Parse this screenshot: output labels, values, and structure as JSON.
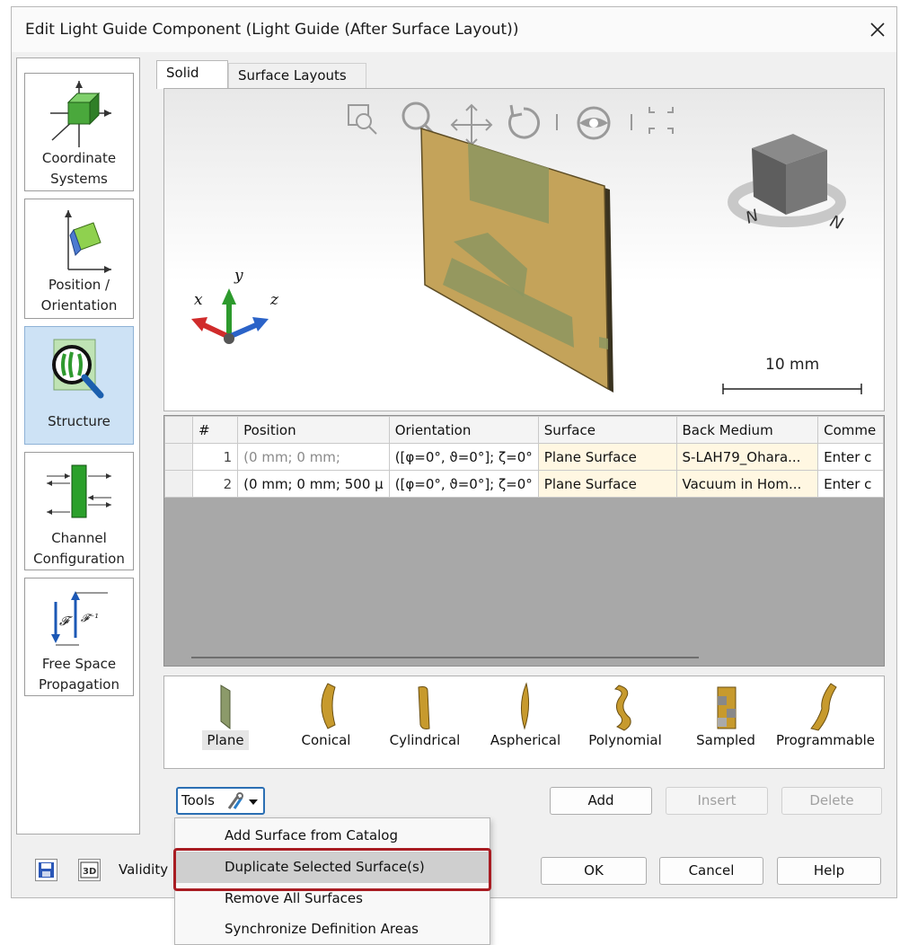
{
  "window": {
    "title": "Edit Light Guide Component (Light Guide (After Surface Layout))"
  },
  "nav": {
    "items": [
      {
        "label1": "Coordinate",
        "label2": "Systems"
      },
      {
        "label1": "Position /",
        "label2": "Orientation"
      },
      {
        "label1": "Structure",
        "label2": ""
      },
      {
        "label1": "Channel",
        "label2": "Configuration"
      },
      {
        "label1": "Free Space",
        "label2": "Propagation"
      }
    ]
  },
  "tabs": [
    {
      "label": "Solid"
    },
    {
      "label": "Surface Layouts"
    }
  ],
  "viewport": {
    "scale_label": "10 mm",
    "axis_x": "x",
    "axis_y": "y",
    "axis_z": "z",
    "toolbar_icons": [
      "zoom-region-icon",
      "zoom-icon",
      "pan-icon",
      "rotate-icon",
      "view-icon",
      "fit-icon"
    ],
    "surface_color": "#c4a35a"
  },
  "table": {
    "columns": [
      "#",
      "Position",
      "Orientation",
      "Surface",
      "Back Medium",
      "Comme"
    ],
    "rows": [
      {
        "num": "1",
        "position": "(0 mm; 0 mm;",
        "orientation": "([φ=0°, ϑ=0°]; ζ=0°",
        "surface": "Plane Surface",
        "medium": "S-LAH79_Ohara...",
        "comment": "Enter c"
      },
      {
        "num": "2",
        "position": "(0 mm; 0 mm; 500 µ",
        "orientation": "([φ=0°, ϑ=0°]; ζ=0°",
        "surface": "Plane Surface",
        "medium": "Vacuum in Hom...",
        "comment": "Enter c"
      }
    ]
  },
  "gallery": {
    "items": [
      {
        "label": "Plane"
      },
      {
        "label": "Conical"
      },
      {
        "label": "Cylindrical"
      },
      {
        "label": "Aspherical"
      },
      {
        "label": "Polynomial"
      },
      {
        "label": "Sampled"
      },
      {
        "label": "Programmable"
      }
    ]
  },
  "buttons": {
    "tools": "Tools",
    "add": "Add",
    "insert": "Insert",
    "delete": "Delete",
    "ok": "OK",
    "cancel": "Cancel",
    "help": "Help"
  },
  "footer": {
    "validity": "Validity"
  },
  "menu": {
    "items": [
      {
        "label": "Add Surface from Catalog"
      },
      {
        "label": "Duplicate Selected Surface(s)"
      },
      {
        "label": "Remove All Surfaces"
      },
      {
        "label": "Synchronize Definition Areas"
      }
    ]
  }
}
